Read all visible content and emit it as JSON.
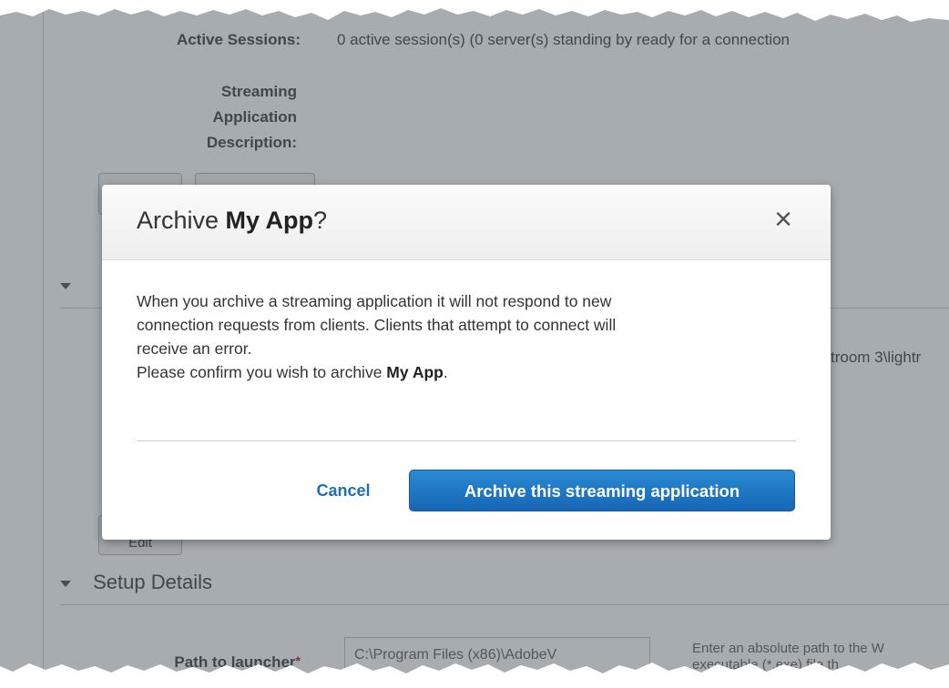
{
  "page": {
    "fields": {
      "active_sessions_label": "Active Sessions:",
      "active_sessions_value": "0 active session(s) (0 server(s) standing by ready for a connection",
      "description_label_1": "Streaming",
      "description_label_2": "Application",
      "description_label_3": "Description:"
    },
    "partial_path_text": "troom 3\\lightr",
    "section_setup_details": "Setup Details",
    "ghost_button_label": "Edit",
    "path_label": "Path to launcher",
    "path_required_mark": "*",
    "path_value": "C:\\Program Files (x86)\\AdobeV",
    "hint_line_1": "Enter an absolute path to the W",
    "hint_line_2": "executable (*.exe) file th"
  },
  "modal": {
    "title_prefix": "Archive ",
    "title_app": "My App",
    "title_suffix": "?",
    "close_glyph": "×",
    "body_line_1": "When you archive a streaming application it will not respond to new",
    "body_line_2": "connection requests from clients. Clients that attempt to connect will",
    "body_line_3": "receive an error.",
    "body_confirm_prefix": "Please confirm you wish to archive ",
    "body_confirm_app": "My App",
    "body_confirm_suffix": ".",
    "cancel_label": "Cancel",
    "archive_label": "Archive this streaming application"
  },
  "colors": {
    "primary_button": "#1f74c3",
    "link": "#1f6fb2",
    "overlay": "rgba(80,90,100,0.5)"
  }
}
